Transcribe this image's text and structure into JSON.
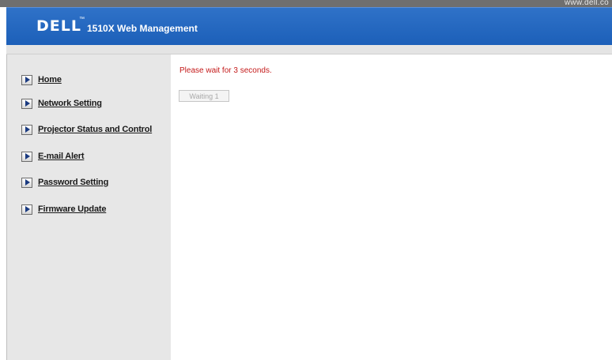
{
  "topbar": {
    "url_text": "www.dell.co"
  },
  "header": {
    "logo_text": "DELL",
    "logo_tm": "™",
    "title": "1510X Web Management"
  },
  "sidebar": {
    "items": [
      {
        "label": "Home"
      },
      {
        "label": "Network Setting"
      },
      {
        "label": "Projector Status and Control"
      },
      {
        "label": "E-mail Alert"
      },
      {
        "label": "Password Setting"
      },
      {
        "label": "Firmware Update"
      }
    ]
  },
  "main": {
    "wait_message": "Please wait for 3 seconds.",
    "wait_button_label": "Waiting 1"
  },
  "colors": {
    "header_blue": "#1c5fb8",
    "sidebar_gray": "#e7e7e7",
    "message_red": "#c41a1a"
  }
}
